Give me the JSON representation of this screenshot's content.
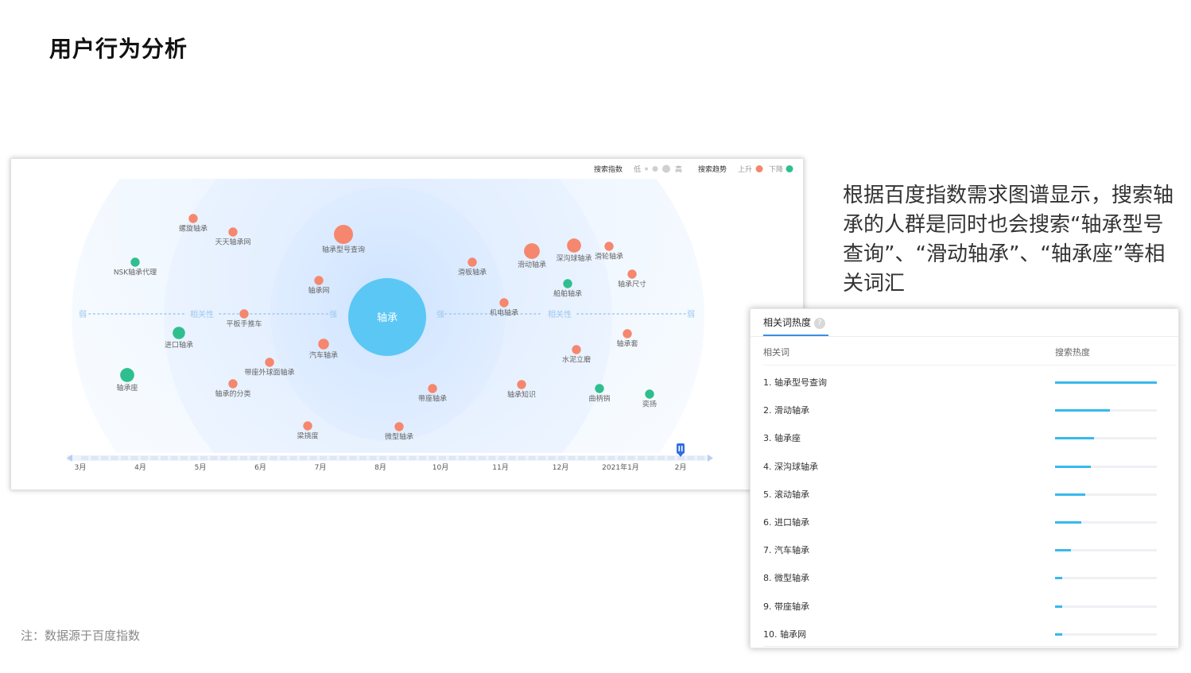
{
  "page": {
    "title": "用户行为分析",
    "footnote": "注：数据源于百度指数"
  },
  "description": "根据百度指数需求图谱显示，搜索轴承的人群是同时也会搜索“轴承型号查询”、“滑动轴承”、“轴承座”等相关词汇",
  "graph": {
    "legend": {
      "index_label": "搜索指数",
      "low": "低",
      "high": "高",
      "trend_label": "搜索趋势",
      "up": "上升",
      "down": "下降"
    },
    "colors": {
      "rise": "#f5876e",
      "fall": "#2fbf8f",
      "center": "#5bc7f5",
      "axis": "#9ec7ef"
    },
    "center_term": "轴承",
    "axis_labels": {
      "weak_left": "弱",
      "relevance_left": "相关性",
      "strong_left": "强",
      "strong_right": "强",
      "relevance_right": "相关性",
      "weak_right": "弱"
    },
    "terms": [
      {
        "label": "螺旋轴承",
        "trend": "up",
        "index": 2
      },
      {
        "label": "天天轴承网",
        "trend": "up",
        "index": 2
      },
      {
        "label": "NSK轴承代理",
        "trend": "down",
        "index": 2
      },
      {
        "label": "轴承型号查询",
        "trend": "up",
        "index": 5
      },
      {
        "label": "轴承网",
        "trend": "up",
        "index": 2
      },
      {
        "label": "平板手推车",
        "trend": "up",
        "index": 2
      },
      {
        "label": "进口轴承",
        "trend": "down",
        "index": 3
      },
      {
        "label": "汽车轴承",
        "trend": "up",
        "index": 2.5
      },
      {
        "label": "带座外球面轴承",
        "trend": "up",
        "index": 2
      },
      {
        "label": "轴承座",
        "trend": "down",
        "index": 3.5
      },
      {
        "label": "轴承的分类",
        "trend": "up",
        "index": 2
      },
      {
        "label": "梁挠度",
        "trend": "up",
        "index": 2
      },
      {
        "label": "微型轴承",
        "trend": "up",
        "index": 2
      },
      {
        "label": "带座轴承",
        "trend": "up",
        "index": 2
      },
      {
        "label": "滑板轴承",
        "trend": "up",
        "index": 2
      },
      {
        "label": "机电轴承",
        "trend": "up",
        "index": 2
      },
      {
        "label": "滑动轴承",
        "trend": "up",
        "index": 4
      },
      {
        "label": "深沟球轴承",
        "trend": "up",
        "index": 3.5
      },
      {
        "label": "滑轮轴承",
        "trend": "up",
        "index": 2
      },
      {
        "label": "轴承尺寸",
        "trend": "up",
        "index": 2
      },
      {
        "label": "船舶轴承",
        "trend": "down",
        "index": 2
      },
      {
        "label": "轴承套",
        "trend": "up",
        "index": 2
      },
      {
        "label": "水泥立磨",
        "trend": "up",
        "index": 2
      },
      {
        "label": "轴承知识",
        "trend": "up",
        "index": 2
      },
      {
        "label": "曲柄销",
        "trend": "down",
        "index": 2
      },
      {
        "label": "奕扬",
        "trend": "down",
        "index": 2
      }
    ],
    "timeline": {
      "months": [
        "3月",
        "4月",
        "5月",
        "6月",
        "7月",
        "8月",
        "10月",
        "11月",
        "12月",
        "2021年1月",
        "2月"
      ],
      "pause_icon": "pause-icon"
    }
  },
  "ranking": {
    "tab_label": "相关词热度",
    "help_icon": "?",
    "col_word": "相关词",
    "col_heat": "搜索热度",
    "items": [
      {
        "label": "1.   轴承型号查询",
        "value": 1.0
      },
      {
        "label": "2.   滑动轴承",
        "value": 0.54
      },
      {
        "label": "3.   轴承座",
        "value": 0.38
      },
      {
        "label": "4.   深沟球轴承",
        "value": 0.35
      },
      {
        "label": "5.   滚动轴承",
        "value": 0.3
      },
      {
        "label": "6.   进口轴承",
        "value": 0.26
      },
      {
        "label": "7.   汽车轴承",
        "value": 0.16
      },
      {
        "label": "8.   微型轴承",
        "value": 0.07
      },
      {
        "label": "9.   带座轴承",
        "value": 0.07
      },
      {
        "label": "10. 轴承网",
        "value": 0.07
      }
    ]
  }
}
